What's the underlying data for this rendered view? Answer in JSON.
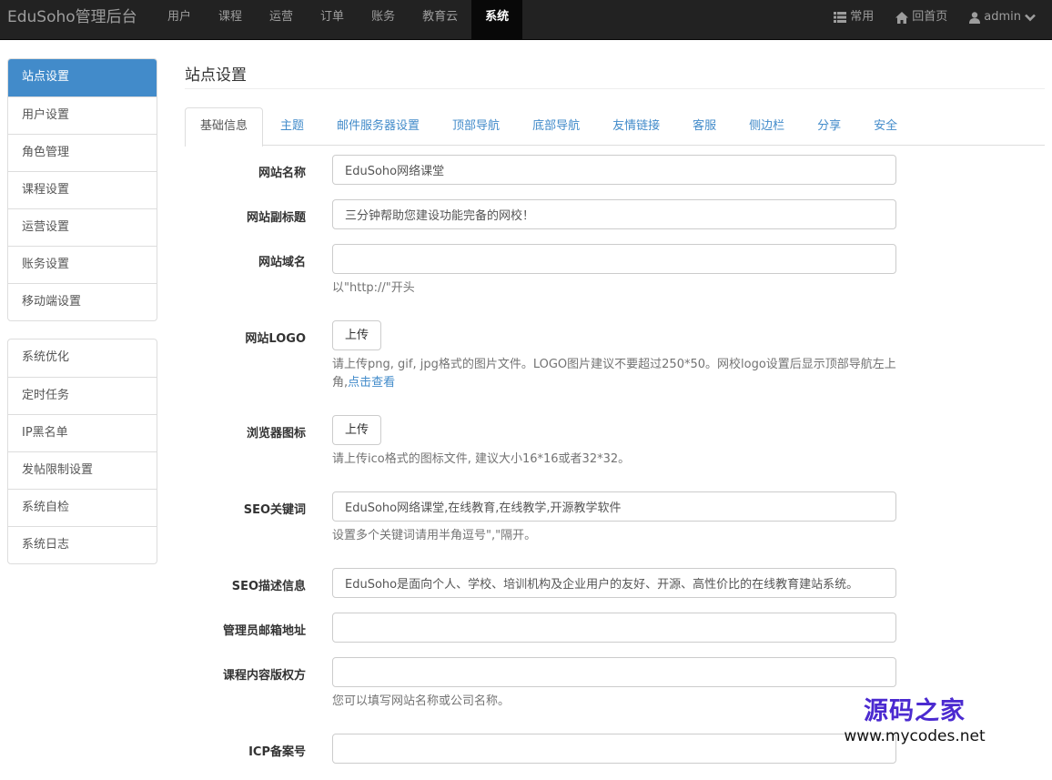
{
  "navbar": {
    "brand": "EduSoho管理后台",
    "items": [
      "用户",
      "课程",
      "运营",
      "订单",
      "账务",
      "教育云",
      "系统"
    ],
    "active_index": 6,
    "right": {
      "common": "常用",
      "home": "回首页",
      "user": "admin"
    }
  },
  "sidebar": {
    "group1": [
      "站点设置",
      "用户设置",
      "角色管理",
      "课程设置",
      "运营设置",
      "账务设置",
      "移动端设置"
    ],
    "group2": [
      "系统优化",
      "定时任务",
      "IP黑名单",
      "发帖限制设置",
      "系统自检",
      "系统日志"
    ]
  },
  "page": {
    "title": "站点设置"
  },
  "tabs": [
    "基础信息",
    "主题",
    "邮件服务器设置",
    "顶部导航",
    "底部导航",
    "友情链接",
    "客服",
    "侧边栏",
    "分享",
    "安全"
  ],
  "form": {
    "site_name": {
      "label": "网站名称",
      "value": "EduSoho网络课堂"
    },
    "site_subtitle": {
      "label": "网站副标题",
      "value": "三分钟帮助您建设功能完备的网校！"
    },
    "site_domain": {
      "label": "网站域名",
      "value": "",
      "help": "以\"http://\"开头"
    },
    "site_logo": {
      "label": "网站LOGO",
      "button": "上传",
      "help": "请上传png, gif, jpg格式的图片文件。LOGO图片建议不要超过250*50。网校logo设置后显示顶部导航左上角,",
      "help_link": "点击查看"
    },
    "favicon": {
      "label": "浏览器图标",
      "button": "上传",
      "help": "请上传ico格式的图标文件, 建议大小16*16或者32*32。"
    },
    "seo_keywords": {
      "label": "SEO关键词",
      "value": "EduSoho网络课堂,在线教育,在线教学,开源教学软件",
      "help": "设置多个关键词请用半角逗号\",\"隔开。"
    },
    "seo_description": {
      "label": "SEO描述信息",
      "value": "EduSoho是面向个人、学校、培训机构及企业用户的友好、开源、高性价比的在线教育建站系统。"
    },
    "admin_email": {
      "label": "管理员邮箱地址",
      "value": ""
    },
    "copyright": {
      "label": "课程内容版权方",
      "value": "",
      "help": "您可以填写网站名称或公司名称。"
    },
    "icp": {
      "label": "ICP备案号",
      "value": ""
    }
  },
  "watermark": {
    "cn": "源码之家",
    "url": "www.mycodes.net"
  }
}
